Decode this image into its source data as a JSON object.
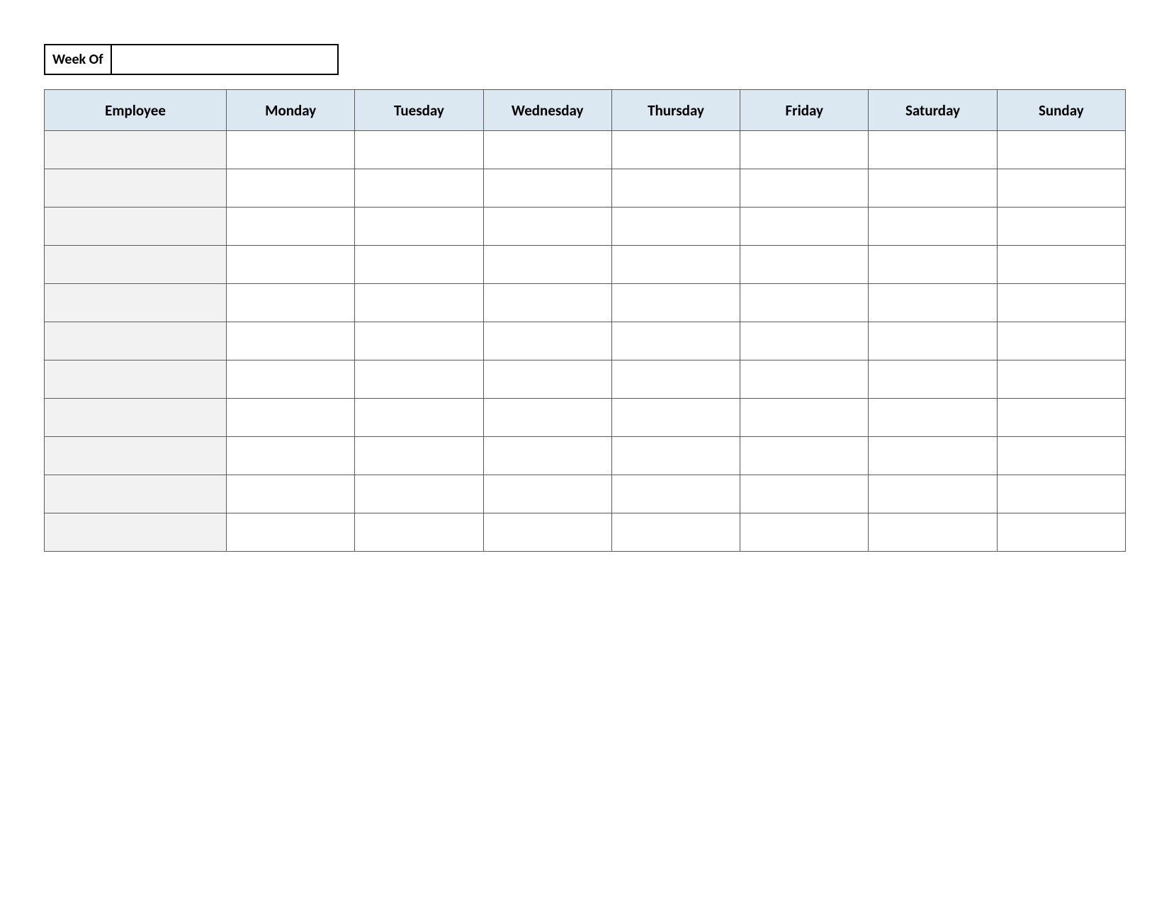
{
  "weekof_label": "Week Of",
  "weekof_value": "",
  "headers": {
    "employee": "Employee",
    "days": [
      "Monday",
      "Tuesday",
      "Wednesday",
      "Thursday",
      "Friday",
      "Saturday",
      "Sunday"
    ]
  },
  "rows": [
    {
      "employee": "",
      "days": [
        "",
        "",
        "",
        "",
        "",
        "",
        ""
      ]
    },
    {
      "employee": "",
      "days": [
        "",
        "",
        "",
        "",
        "",
        "",
        ""
      ]
    },
    {
      "employee": "",
      "days": [
        "",
        "",
        "",
        "",
        "",
        "",
        ""
      ]
    },
    {
      "employee": "",
      "days": [
        "",
        "",
        "",
        "",
        "",
        "",
        ""
      ]
    },
    {
      "employee": "",
      "days": [
        "",
        "",
        "",
        "",
        "",
        "",
        ""
      ]
    },
    {
      "employee": "",
      "days": [
        "",
        "",
        "",
        "",
        "",
        "",
        ""
      ]
    },
    {
      "employee": "",
      "days": [
        "",
        "",
        "",
        "",
        "",
        "",
        ""
      ]
    },
    {
      "employee": "",
      "days": [
        "",
        "",
        "",
        "",
        "",
        "",
        ""
      ]
    },
    {
      "employee": "",
      "days": [
        "",
        "",
        "",
        "",
        "",
        "",
        ""
      ]
    },
    {
      "employee": "",
      "days": [
        "",
        "",
        "",
        "",
        "",
        "",
        ""
      ]
    },
    {
      "employee": "",
      "days": [
        "",
        "",
        "",
        "",
        "",
        "",
        ""
      ]
    }
  ]
}
